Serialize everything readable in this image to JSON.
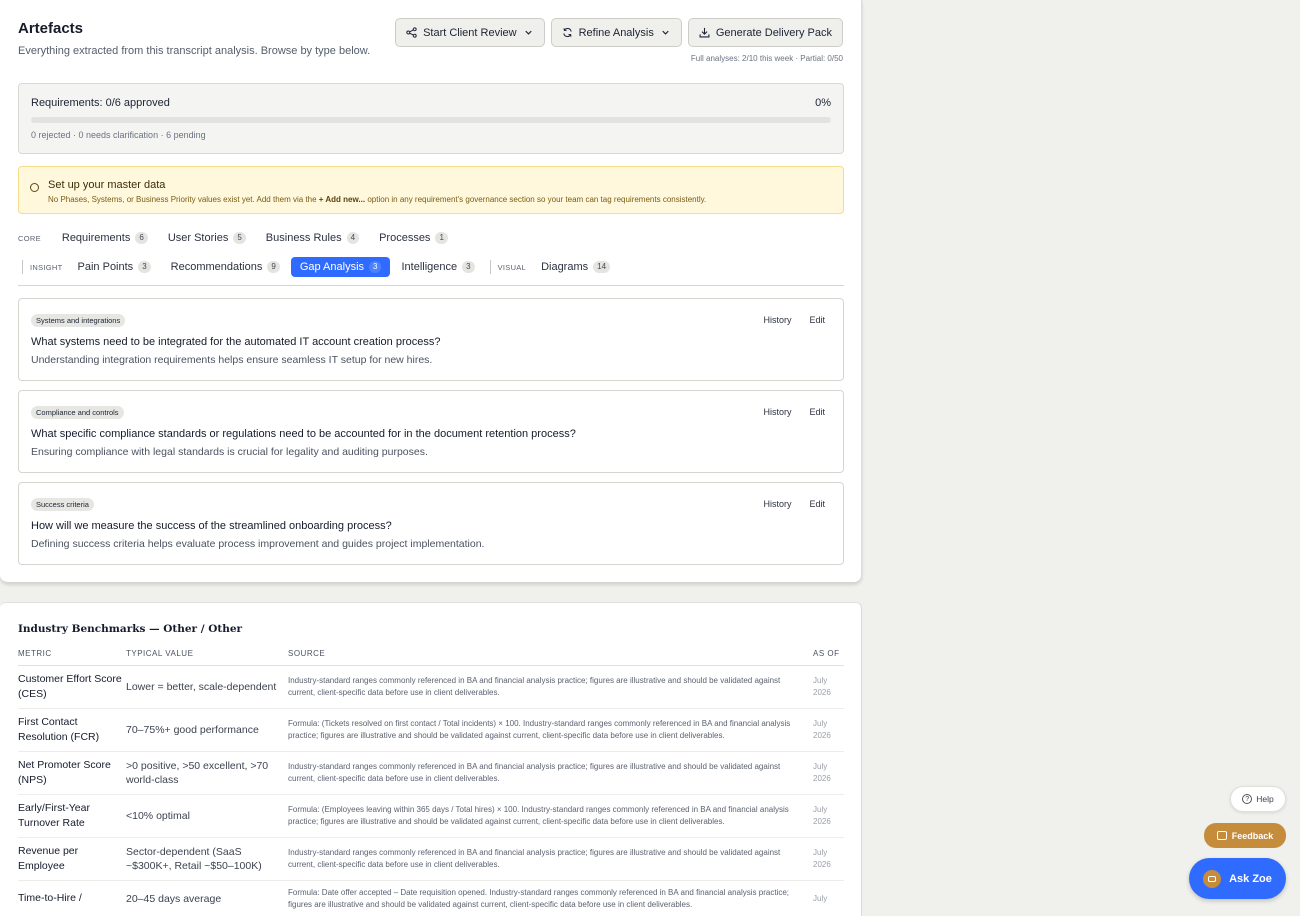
{
  "header": {
    "title": "Artefacts",
    "subtitle": "Everything extracted from this transcript analysis. Browse by type below.",
    "quota": "Full analyses: 2/10 this week · Partial: 0/50"
  },
  "toolbar": {
    "start_review": "Start Client Review",
    "refine": "Refine Analysis",
    "delivery": "Generate Delivery Pack"
  },
  "requirements": {
    "title": "Requirements: 0/6 approved",
    "percent": "0%",
    "progress": 0,
    "meta": "0 rejected · 0 needs clarification · 6 pending"
  },
  "alert": {
    "title": "Set up your master data",
    "text_before": "No Phases, Systems, or Business Priority values exist yet. Add them via the",
    "link": "+ Add new...",
    "text_after": "option in any requirement's governance section so your team can tag requirements consistently."
  },
  "tabs": {
    "core_label": "CORE",
    "insight_label": "INSIGHT",
    "visual_label": "VISUAL",
    "requirements": {
      "label": "Requirements",
      "count": "6"
    },
    "user_stories": {
      "label": "User Stories",
      "count": "5"
    },
    "business_rules": {
      "label": "Business Rules",
      "count": "4"
    },
    "processes": {
      "label": "Processes",
      "count": "1"
    },
    "pain_points": {
      "label": "Pain Points",
      "count": "3"
    },
    "recommendations": {
      "label": "Recommendations",
      "count": "9"
    },
    "gap_analysis": {
      "label": "Gap Analysis",
      "count": "3"
    },
    "intelligence": {
      "label": "Intelligence",
      "count": "3"
    },
    "diagrams": {
      "label": "Diagrams",
      "count": "14"
    }
  },
  "gaps": [
    {
      "tag": "Systems and integrations",
      "question": "What systems need to be integrated for the automated IT account creation process?",
      "description": "Understanding integration requirements helps ensure seamless IT setup for new hires.",
      "history": "History",
      "edit": "Edit"
    },
    {
      "tag": "Compliance and controls",
      "question": "What specific compliance standards or regulations need to be accounted for in the document retention process?",
      "description": "Ensuring compliance with legal standards is crucial for legality and auditing purposes.",
      "history": "History",
      "edit": "Edit"
    },
    {
      "tag": "Success criteria",
      "question": "How will we measure the success of the streamlined onboarding process?",
      "description": "Defining success criteria helps evaluate process improvement and guides project implementation.",
      "history": "History",
      "edit": "Edit"
    }
  ],
  "benchmarks": {
    "title": "Industry Benchmarks — Other / Other",
    "columns": {
      "metric": "METRIC",
      "typical": "TYPICAL VALUE",
      "source": "SOURCE",
      "asof": "AS OF"
    },
    "rows": [
      {
        "metric": "Customer Effort Score (CES)",
        "typical": "Lower = better, scale-dependent",
        "source": "Industry-standard ranges commonly referenced in BA and financial analysis practice; figures are illustrative and should be validated against current, client-specific data before use in client deliverables.",
        "asof": "July 2026"
      },
      {
        "metric": "First Contact Resolution (FCR)",
        "typical": "70–75%+ good performance",
        "source": "Formula: (Tickets resolved on first contact / Total incidents) × 100. Industry-standard ranges commonly referenced in BA and financial analysis practice; figures are illustrative and should be validated against current, client-specific data before use in client deliverables.",
        "asof": "July 2026"
      },
      {
        "metric": "Net Promoter Score (NPS)",
        "typical": ">0 positive, >50 excellent, >70 world-class",
        "source": "Industry-standard ranges commonly referenced in BA and financial analysis practice; figures are illustrative and should be validated against current, client-specific data before use in client deliverables.",
        "asof": "July 2026"
      },
      {
        "metric": "Early/First-Year Turnover Rate",
        "typical": "<10% optimal",
        "source": "Formula: (Employees leaving within 365 days / Total hires) × 100. Industry-standard ranges commonly referenced in BA and financial analysis practice; figures are illustrative and should be validated against current, client-specific data before use in client deliverables.",
        "asof": "July 2026"
      },
      {
        "metric": "Revenue per Employee",
        "typical": "Sector-dependent (SaaS ~$300K+, Retail ~$50–100K)",
        "source": "Industry-standard ranges commonly referenced in BA and financial analysis practice; figures are illustrative and should be validated against current, client-specific data before use in client deliverables.",
        "asof": "July 2026"
      },
      {
        "metric": "Time-to-Hire /",
        "typical": "20–45 days average",
        "source": "Formula: Date offer accepted – Date requisition opened. Industry-standard ranges commonly referenced in BA and financial analysis practice; figures are illustrative and should be validated against current, client-specific data before use in client deliverables.",
        "asof": "July"
      }
    ]
  },
  "floating": {
    "help": "Help",
    "feedback": "Feedback",
    "ask_zoe": "Ask Zoe"
  },
  "colors": {
    "accent": "#2f6bff",
    "alert_bg": "#fff8dc",
    "feedback": "#c58c3c"
  },
  "icons": {
    "start_review": "share-icon",
    "refine": "refresh-icon",
    "delivery": "download-icon",
    "chevron": "chevron-down-icon",
    "alert": "settings-icon"
  }
}
